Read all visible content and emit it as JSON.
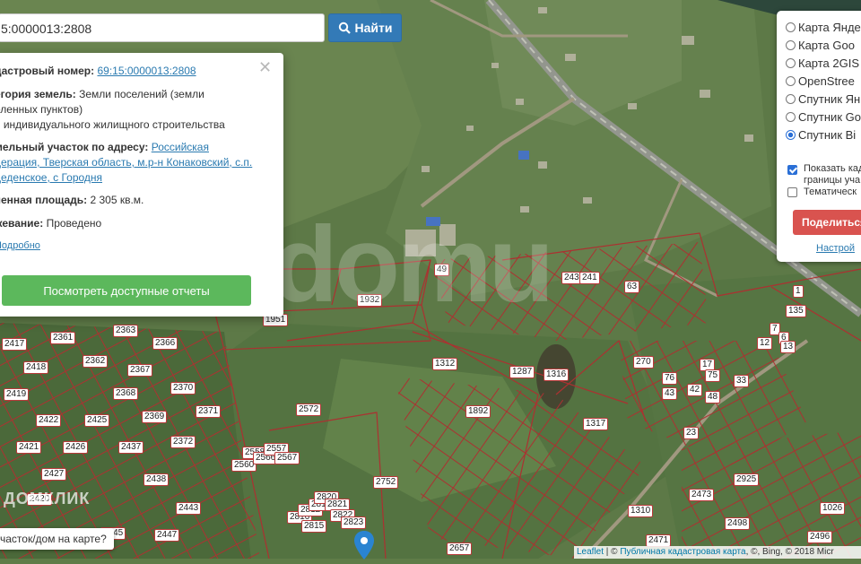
{
  "search": {
    "value": "5:0000013:2808",
    "button_label": "Найти"
  },
  "popup": {
    "cadastral_label": "дастровый номер:",
    "cadastral_value": "69:15:0000013:2808",
    "category_label": "егория земель:",
    "category_value": "Земли поселений (земли",
    "category_line2": "еленных пунктов)",
    "category_line3": "я индивидуального жилищного строительства",
    "address_label": "мельный участок по адресу:",
    "address_link1": "Российская",
    "address_link2": "дерация, Тверская область, м.р-н Конаковский, с.п.",
    "address_link3": "деденское, с Городня",
    "area_label": "ченная площадь:",
    "area_value": "2 305 кв.м.",
    "survey_label": "жевание:",
    "survey_value": "Проведено",
    "more_link": "Подробно",
    "report_button": "Посмотреть доступные отчеты"
  },
  "layers": {
    "options": [
      {
        "label": "Карта Янде",
        "selected": false
      },
      {
        "label": "Карта Goo",
        "selected": false
      },
      {
        "label": "Карта 2GIS",
        "selected": false
      },
      {
        "label": "OpenStree",
        "selected": false
      },
      {
        "label": "Спутник Ян",
        "selected": false
      },
      {
        "label": "Спутник Go",
        "selected": false
      },
      {
        "label": "Спутник Bi",
        "selected": true
      }
    ],
    "show_borders_line1": "Показать када",
    "show_borders_line2": "границы уча",
    "show_borders_checked": true,
    "thematic_label": "Тематическ",
    "thematic_checked": false,
    "share_button": "Поделиться",
    "settings_link": "Настрой"
  },
  "hint": "часток/дом на карте?",
  "attribution": {
    "leaflet": "Leaflet",
    "sep1": " | © ",
    "pkk": "Публичная кадастровая карта",
    "rest": ", ©, Bing, © 2018 Micr"
  },
  "watermark": "mcdomu",
  "domclick": "ДОМКЛИК",
  "parcels": [
    "25",
    "243",
    "241",
    "63",
    "1932",
    "1951",
    "2417",
    "2361",
    "2363",
    "2366",
    "2418",
    "2362",
    "2367",
    "2370",
    "2419",
    "2368",
    "2422",
    "2425",
    "2369",
    "2421",
    "2426",
    "2437",
    "2371",
    "2427",
    "2438",
    "2372",
    "2560",
    "2558",
    "2566",
    "2557",
    "2567",
    "2816",
    "2812",
    "2819",
    "2815",
    "2820",
    "2821",
    "2822",
    "2823",
    "2420",
    "2443",
    "2447",
    "2445",
    "1312",
    "1287",
    "1316",
    "270",
    "2572",
    "1892",
    "1317",
    "2752",
    "2657",
    "1310",
    "2473",
    "2498",
    "2471",
    "2925",
    "1026",
    "2496",
    "135",
    "1",
    "7",
    "6",
    "12",
    "13",
    "17",
    "75",
    "76",
    "43",
    "42",
    "48",
    "33",
    "23",
    "49"
  ]
}
